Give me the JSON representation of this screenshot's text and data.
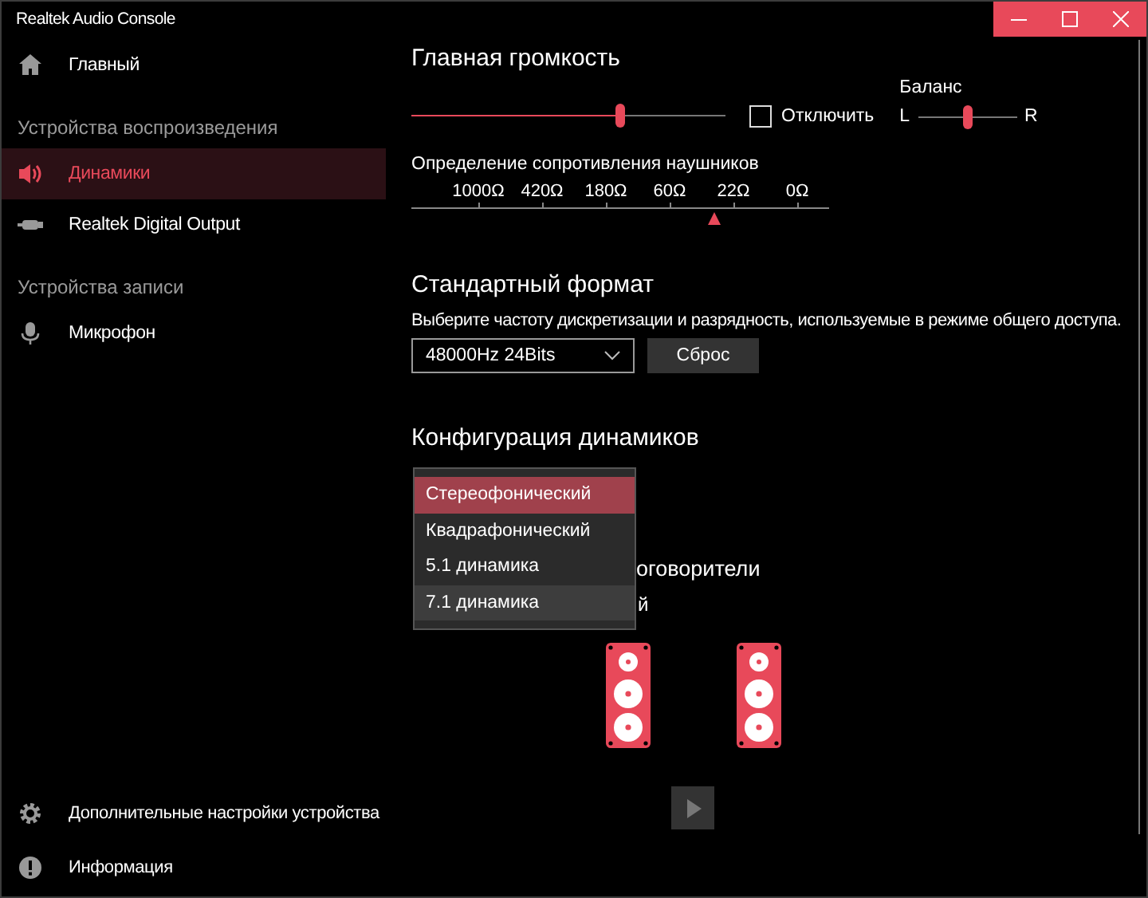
{
  "window": {
    "title": "Realtek Audio Console"
  },
  "sidebar": {
    "items": [
      {
        "kind": "link",
        "label": "Главный",
        "selected": false
      },
      {
        "kind": "heading",
        "label": "Устройства воспроизведения"
      },
      {
        "kind": "link",
        "label": "Динамики",
        "selected": true
      },
      {
        "kind": "link",
        "label": "Realtek Digital Output",
        "selected": false
      },
      {
        "kind": "heading",
        "label": "Устройства записи"
      },
      {
        "kind": "link",
        "label": "Микрофон",
        "selected": false
      }
    ],
    "footer_items": [
      {
        "label": "Дополнительные настройки устройства"
      },
      {
        "label": "Информация"
      }
    ]
  },
  "master_volume": {
    "title": "Главная громкость",
    "level": 0.665,
    "mute": {
      "label": "Отключить",
      "checked": false
    },
    "balance": {
      "label": "Баланс",
      "left": "L",
      "right": "R",
      "level": 0.5
    }
  },
  "impedance": {
    "title": "Определение сопротивления наушников",
    "scale": [
      "1000Ω",
      "420Ω",
      "180Ω",
      "60Ω",
      "22Ω",
      "0Ω"
    ],
    "level": 0.725
  },
  "default_format": {
    "title": "Стандартный формат",
    "description": "Выберите частоту дискретизации и разрядность, используемые в режиме общего доступа.",
    "format": {
      "value": "48000Hz 24Bits"
    },
    "reset_button": "Сброс"
  },
  "speaker_config": {
    "title": "Конфигурация динамиков",
    "options": [
      {
        "label": "Стереофонический",
        "selected": true,
        "hovered": false
      },
      {
        "label": "Квадрафонический",
        "selected": false,
        "hovered": false
      },
      {
        "label": "5.1 динамика",
        "selected": false,
        "hovered": false
      },
      {
        "label": "7.1 динамика",
        "selected": false,
        "hovered": true
      }
    ],
    "hidden_texts": [
      "оговорители",
      "й"
    ]
  }
}
